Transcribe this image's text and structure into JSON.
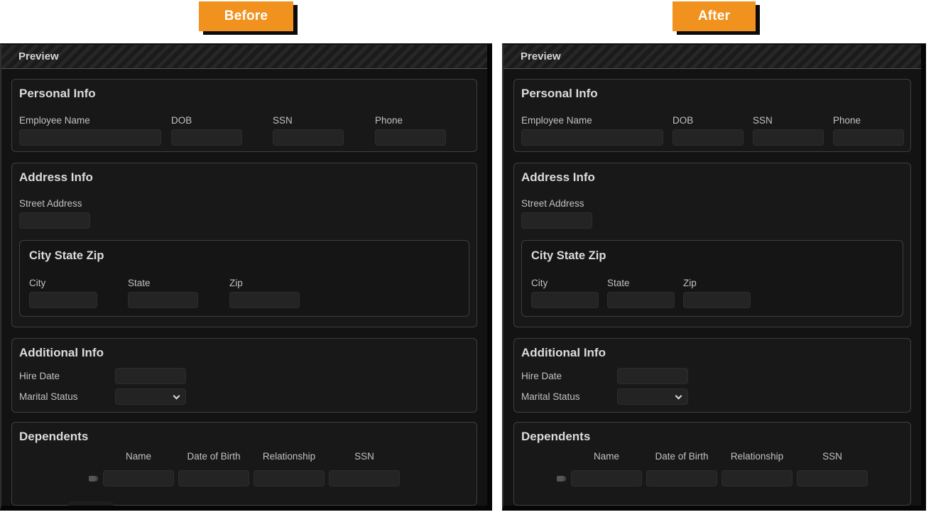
{
  "buttons": {
    "before": "Before",
    "after": "After",
    "accent_color": "#f1921e"
  },
  "preview": {
    "title": "Preview",
    "personal": {
      "title": "Personal Info",
      "fields": [
        {
          "label": "Employee Name",
          "value": ""
        },
        {
          "label": "DOB",
          "value": ""
        },
        {
          "label": "SSN",
          "value": ""
        },
        {
          "label": "Phone",
          "value": ""
        }
      ]
    },
    "address": {
      "title": "Address Info",
      "street": {
        "label": "Street Address",
        "value": ""
      },
      "city_state_zip": {
        "title": "City State Zip",
        "fields": [
          {
            "label": "City",
            "value": ""
          },
          {
            "label": "State",
            "value": ""
          },
          {
            "label": "Zip",
            "value": ""
          }
        ]
      }
    },
    "additional": {
      "title": "Additional Info",
      "hire_date": {
        "label": "Hire Date",
        "value": ""
      },
      "marital_status": {
        "label": "Marital Status",
        "selected": ""
      }
    },
    "dependents": {
      "title": "Dependents",
      "columns": [
        {
          "label": "Name"
        },
        {
          "label": "Date of Birth"
        },
        {
          "label": "Relationship"
        },
        {
          "label": "SSN"
        }
      ]
    }
  },
  "colors": {
    "panel_bg": "#131313",
    "section_bg": "#181818",
    "input_bg": "#242424",
    "border": "#3f3f3f",
    "text": "#c2c2c2",
    "title": "#dcdcdc"
  }
}
